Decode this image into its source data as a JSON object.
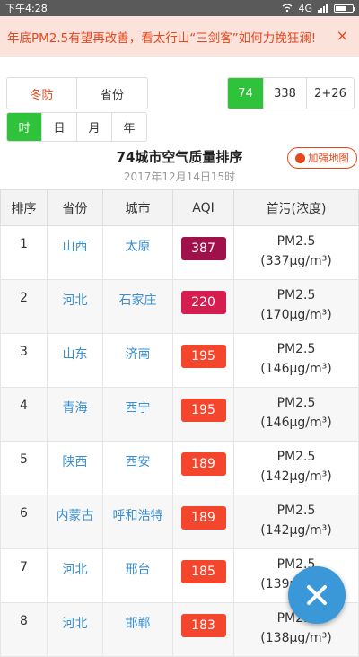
{
  "status_bar": {
    "time": "下午4:28",
    "network": "4G"
  },
  "banner": {
    "text": "年底PM2.5有望再改善，看太行山“三剑客”如何力挽狂澜!",
    "close": "×"
  },
  "tabs": {
    "category": [
      "冬防",
      "省份"
    ],
    "group": [
      "74",
      "338",
      "2+26"
    ],
    "period": [
      "时",
      "日",
      "月",
      "年"
    ]
  },
  "header": {
    "title": "74城市空气质量排序",
    "date": "2017年12月14日15时",
    "map_button": "加强地图"
  },
  "table": {
    "columns": [
      "排序",
      "省份",
      "城市",
      "AQI",
      "首污(浓度)"
    ],
    "rows": [
      {
        "rank": "1",
        "province": "山西",
        "city": "太原",
        "aqi": "387",
        "pollutant": "PM2.5",
        "concentration": "(337μg/m³)",
        "color": "#a0104a"
      },
      {
        "rank": "2",
        "province": "河北",
        "city": "石家庄",
        "aqi": "220",
        "pollutant": "PM2.5",
        "concentration": "(170μg/m³)",
        "color": "#d61d4f"
      },
      {
        "rank": "3",
        "province": "山东",
        "city": "济南",
        "aqi": "195",
        "pollutant": "PM2.5",
        "concentration": "(146μg/m³)",
        "color": "#f4462c"
      },
      {
        "rank": "4",
        "province": "青海",
        "city": "西宁",
        "aqi": "195",
        "pollutant": "PM2.5",
        "concentration": "(146μg/m³)",
        "color": "#f4462c"
      },
      {
        "rank": "5",
        "province": "陕西",
        "city": "西安",
        "aqi": "189",
        "pollutant": "PM2.5",
        "concentration": "(142μg/m³)",
        "color": "#f4462c"
      },
      {
        "rank": "6",
        "province": "内蒙古",
        "city": "呼和浩特",
        "aqi": "189",
        "pollutant": "PM2.5",
        "concentration": "(142μg/m³)",
        "color": "#f4462c"
      },
      {
        "rank": "7",
        "province": "河北",
        "city": "邢台",
        "aqi": "185",
        "pollutant": "PM2.5",
        "concentration": "(139μg/m³)",
        "color": "#f4462c"
      },
      {
        "rank": "8",
        "province": "河北",
        "city": "邯郸",
        "aqi": "183",
        "pollutant": "PM2.5",
        "concentration": "(138μg/m³)",
        "color": "#f4462c"
      }
    ]
  },
  "colors": {
    "accent_green": "#2fc23b",
    "accent_red": "#e8461b",
    "link_blue": "#3a8fd0",
    "fab_blue": "#3a97d8"
  },
  "icons": {
    "fab": "close-icon",
    "map": "drop-icon"
  }
}
